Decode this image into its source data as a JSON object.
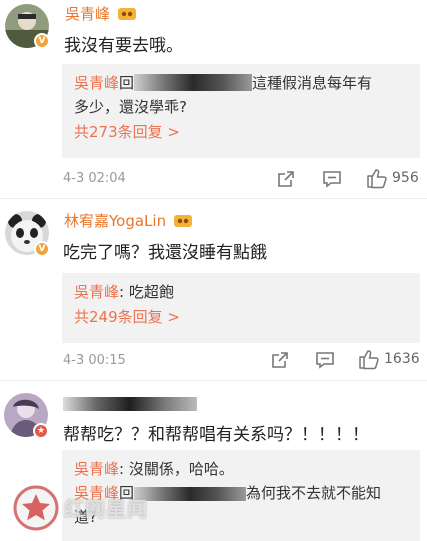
{
  "comments": [
    {
      "username": "吳青峰",
      "text": "我沒有要去哦。",
      "reply": {
        "user": "吳青峰",
        "prefix": "回",
        "text_after": "這種假消息每年有",
        "text_line2": "多少，還沒學乖?"
      },
      "more": "共273条回复 >",
      "time": "4-3 02:04",
      "likes": "956"
    },
    {
      "username": "林宥嘉YogaLin",
      "text": "吃完了嗎？我還沒睡有點餓",
      "reply": {
        "user": "吳青峰",
        "text": ": 吃超飽"
      },
      "more": "共249条回复 >",
      "time": "4-3 00:15",
      "likes": "1636"
    },
    {
      "text": "帮帮吃？？和帮帮唱有关系吗？！！！！",
      "reply": {
        "user": "吳青峰",
        "text": ": 沒關係，哈哈。",
        "user2": "吳青峰",
        "prefix2": "回",
        "text2_after": "為何我不去就不能知",
        "text2_line2": "道?"
      }
    }
  ],
  "watermark": {
    "text": "红网星闻"
  },
  "icons": [
    "share-icon",
    "comment-icon",
    "thumbs-up-icon",
    "crown-badge-icon",
    "verified-v-icon"
  ]
}
